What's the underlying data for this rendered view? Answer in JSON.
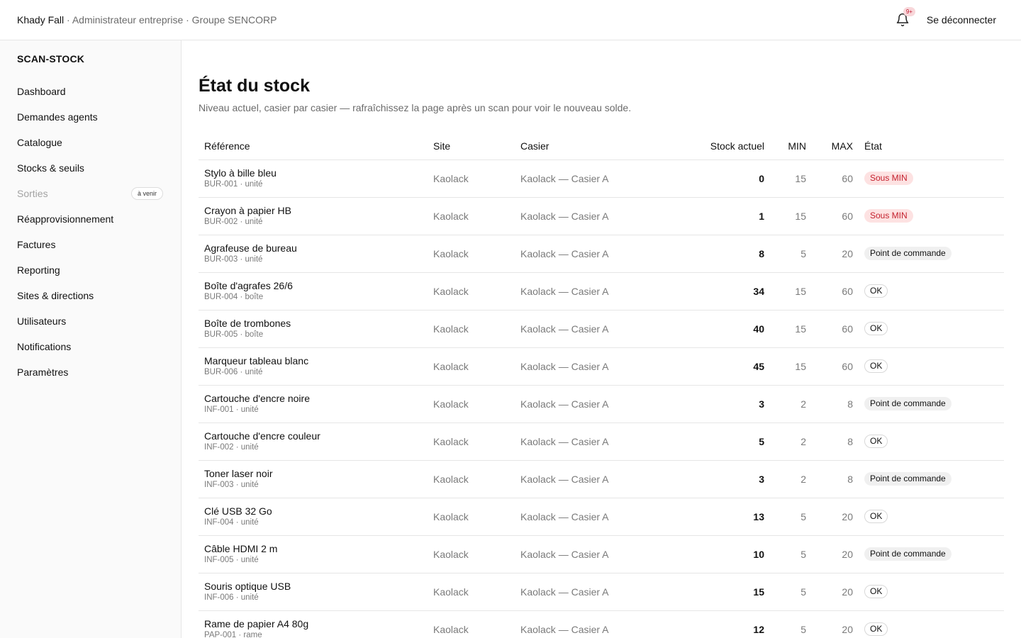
{
  "header": {
    "user_name": "Khady Fall",
    "user_role_org": " · Administrateur entreprise · Groupe SENCORP",
    "notification_count": "9+",
    "logout_label": "Se déconnecter"
  },
  "sidebar": {
    "app_name": "SCAN-STOCK",
    "items": [
      {
        "label": "Dashboard"
      },
      {
        "label": "Demandes agents"
      },
      {
        "label": "Catalogue"
      },
      {
        "label": "Stocks & seuils"
      },
      {
        "label": "Sorties",
        "badge": "à venir"
      },
      {
        "label": "Réapprovisionnement"
      },
      {
        "label": "Factures"
      },
      {
        "label": "Reporting"
      },
      {
        "label": "Sites & directions"
      },
      {
        "label": "Utilisateurs"
      },
      {
        "label": "Notifications"
      },
      {
        "label": "Paramètres"
      }
    ]
  },
  "main": {
    "title": "État du stock",
    "subtitle": "Niveau actuel, casier par casier — rafraîchissez la page après un scan pour voir le nouveau solde.",
    "columns": [
      "Référence",
      "Site",
      "Casier",
      "Stock actuel",
      "MIN",
      "MAX",
      "État"
    ],
    "rows": [
      {
        "name": "Stylo à bille bleu",
        "meta": "BUR-001 · unité",
        "site": "Kaolack",
        "casier": "Kaolack — Casier A",
        "stock": "0",
        "min": "15",
        "max": "60",
        "state": "Sous MIN",
        "state_kind": "under"
      },
      {
        "name": "Crayon à papier HB",
        "meta": "BUR-002 · unité",
        "site": "Kaolack",
        "casier": "Kaolack — Casier A",
        "stock": "1",
        "min": "15",
        "max": "60",
        "state": "Sous MIN",
        "state_kind": "under"
      },
      {
        "name": "Agrafeuse de bureau",
        "meta": "BUR-003 · unité",
        "site": "Kaolack",
        "casier": "Kaolack — Casier A",
        "stock": "8",
        "min": "5",
        "max": "20",
        "state": "Point de commande",
        "state_kind": "reorder"
      },
      {
        "name": "Boîte d'agrafes 26/6",
        "meta": "BUR-004 · boîte",
        "site": "Kaolack",
        "casier": "Kaolack — Casier A",
        "stock": "34",
        "min": "15",
        "max": "60",
        "state": "OK",
        "state_kind": "ok"
      },
      {
        "name": "Boîte de trombones",
        "meta": "BUR-005 · boîte",
        "site": "Kaolack",
        "casier": "Kaolack — Casier A",
        "stock": "40",
        "min": "15",
        "max": "60",
        "state": "OK",
        "state_kind": "ok"
      },
      {
        "name": "Marqueur tableau blanc",
        "meta": "BUR-006 · unité",
        "site": "Kaolack",
        "casier": "Kaolack — Casier A",
        "stock": "45",
        "min": "15",
        "max": "60",
        "state": "OK",
        "state_kind": "ok"
      },
      {
        "name": "Cartouche d'encre noire",
        "meta": "INF-001 · unité",
        "site": "Kaolack",
        "casier": "Kaolack — Casier A",
        "stock": "3",
        "min": "2",
        "max": "8",
        "state": "Point de commande",
        "state_kind": "reorder"
      },
      {
        "name": "Cartouche d'encre couleur",
        "meta": "INF-002 · unité",
        "site": "Kaolack",
        "casier": "Kaolack — Casier A",
        "stock": "5",
        "min": "2",
        "max": "8",
        "state": "OK",
        "state_kind": "ok"
      },
      {
        "name": "Toner laser noir",
        "meta": "INF-003 · unité",
        "site": "Kaolack",
        "casier": "Kaolack — Casier A",
        "stock": "3",
        "min": "2",
        "max": "8",
        "state": "Point de commande",
        "state_kind": "reorder"
      },
      {
        "name": "Clé USB 32 Go",
        "meta": "INF-004 · unité",
        "site": "Kaolack",
        "casier": "Kaolack — Casier A",
        "stock": "13",
        "min": "5",
        "max": "20",
        "state": "OK",
        "state_kind": "ok"
      },
      {
        "name": "Câble HDMI 2 m",
        "meta": "INF-005 · unité",
        "site": "Kaolack",
        "casier": "Kaolack — Casier A",
        "stock": "10",
        "min": "5",
        "max": "20",
        "state": "Point de commande",
        "state_kind": "reorder"
      },
      {
        "name": "Souris optique USB",
        "meta": "INF-006 · unité",
        "site": "Kaolack",
        "casier": "Kaolack — Casier A",
        "stock": "15",
        "min": "5",
        "max": "20",
        "state": "OK",
        "state_kind": "ok"
      },
      {
        "name": "Rame de papier A4 80g",
        "meta": "PAP-001 · rame",
        "site": "Kaolack",
        "casier": "Kaolack — Casier A",
        "stock": "12",
        "min": "5",
        "max": "20",
        "state": "OK",
        "state_kind": "ok"
      }
    ]
  },
  "colors": {
    "under_bg": "#fde2e2",
    "under_text": "#c41f2c",
    "reorder_bg": "#f0f0f0",
    "border": "#e6e6e6",
    "muted_text": "#7a7a7a"
  },
  "icons": {
    "notifications": "bell-icon"
  }
}
